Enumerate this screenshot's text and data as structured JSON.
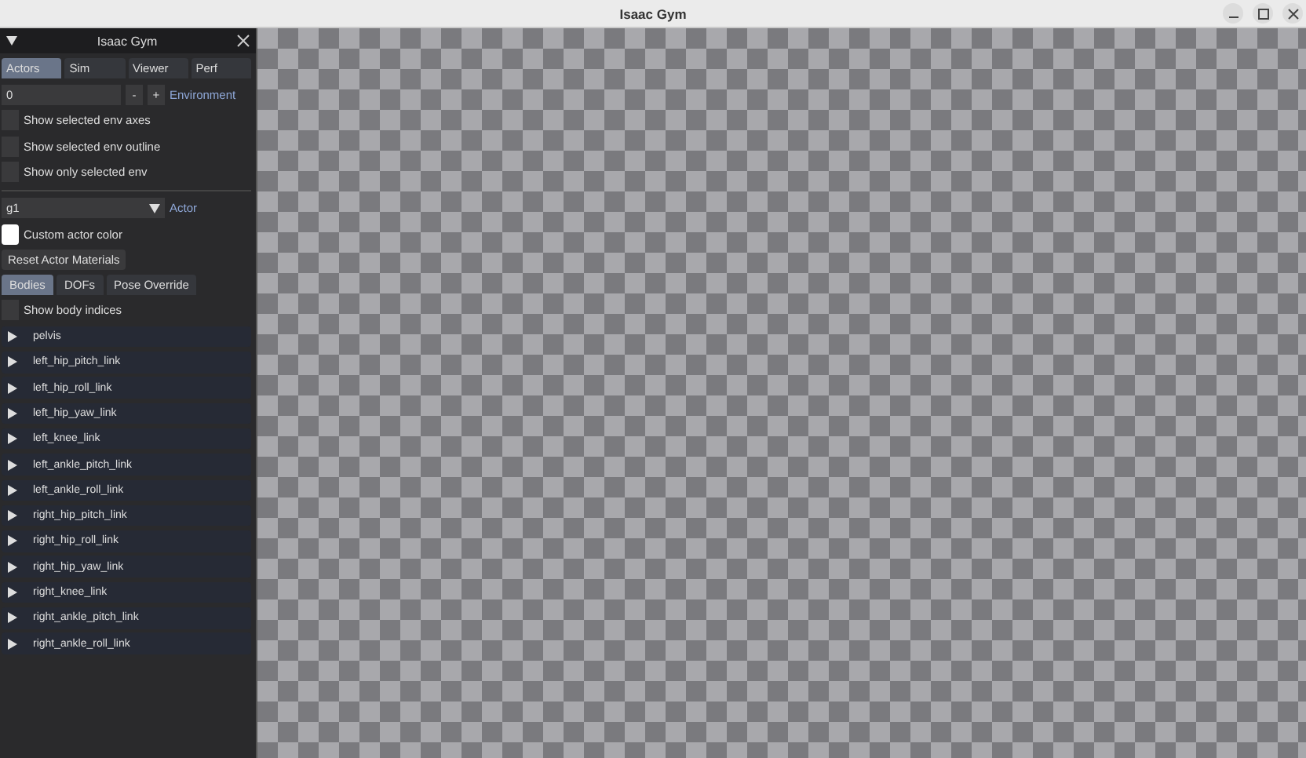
{
  "window": {
    "title": "Isaac Gym"
  },
  "panel": {
    "title": "Isaac Gym",
    "expanded": true,
    "tabs": [
      {
        "label": "Actors",
        "selected": true
      },
      {
        "label": "Sim",
        "selected": false
      },
      {
        "label": "Viewer",
        "selected": false
      },
      {
        "label": "Perf",
        "selected": false
      }
    ],
    "environment": {
      "value": "0",
      "decrement": "-",
      "increment": "+",
      "label": "Environment"
    },
    "env_options": [
      {
        "label": "Show selected env axes",
        "checked": false
      },
      {
        "label": "Show selected env outline",
        "checked": false
      },
      {
        "label": "Show only selected env",
        "checked": false
      }
    ],
    "actor": {
      "value": "g1",
      "label": "Actor"
    },
    "actor_color": {
      "label": "Custom actor color",
      "color": "#ffffff"
    },
    "reset_button": "Reset Actor Materials",
    "subtabs": [
      {
        "label": "Bodies",
        "selected": true
      },
      {
        "label": "DOFs",
        "selected": false
      },
      {
        "label": "Pose Override",
        "selected": false
      }
    ],
    "show_body_indices": {
      "label": "Show body indices",
      "checked": false
    },
    "bodies": [
      {
        "label": "pelvis",
        "expanded": false
      },
      {
        "label": "left_hip_pitch_link",
        "expanded": false
      },
      {
        "label": "left_hip_roll_link",
        "expanded": false
      },
      {
        "label": "left_hip_yaw_link",
        "expanded": false
      },
      {
        "label": "left_knee_link",
        "expanded": false
      },
      {
        "label": "left_ankle_pitch_link",
        "expanded": false
      },
      {
        "label": "left_ankle_roll_link",
        "expanded": false
      },
      {
        "label": "right_hip_pitch_link",
        "expanded": false
      },
      {
        "label": "right_hip_roll_link",
        "expanded": false
      },
      {
        "label": "right_hip_yaw_link",
        "expanded": false
      },
      {
        "label": "right_knee_link",
        "expanded": false
      },
      {
        "label": "right_ankle_pitch_link",
        "expanded": false
      },
      {
        "label": "right_ankle_roll_link",
        "expanded": false
      }
    ]
  }
}
